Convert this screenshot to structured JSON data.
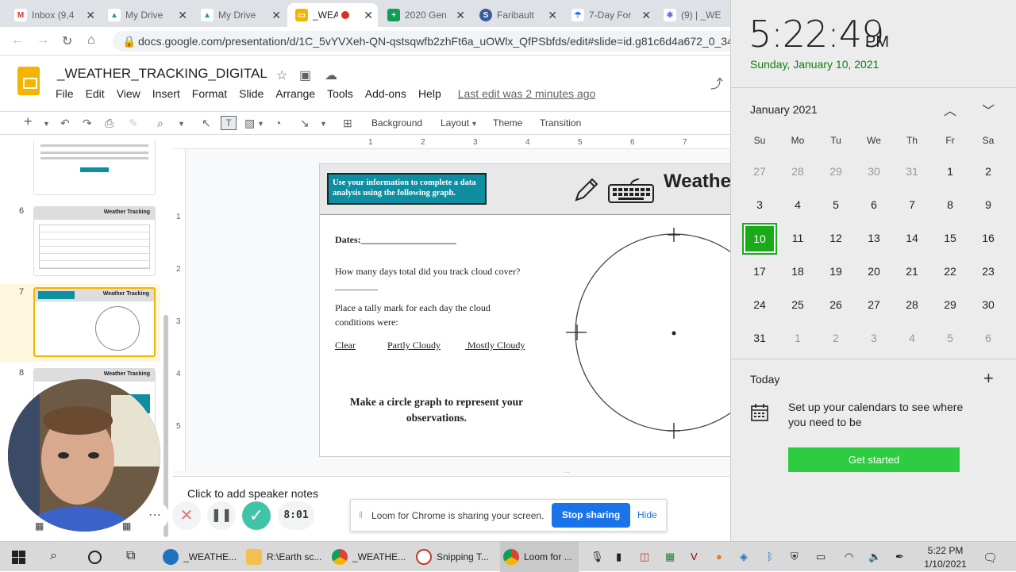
{
  "browser": {
    "tabs": [
      {
        "label": "Inbox (9,4",
        "fav_color": "#d93025",
        "fav": "M"
      },
      {
        "label": "My Drive",
        "fav_color": "#1fa463",
        "fav": "▲"
      },
      {
        "label": "My Drive",
        "fav_color": "#1fa463",
        "fav": "▲"
      },
      {
        "label": "_WEA",
        "fav_color": "#f4b400",
        "fav": "▭"
      },
      {
        "label": "2020 Gen",
        "fav_color": "#0f9d58",
        "fav": "+"
      },
      {
        "label": "Faribault",
        "fav_color": "#3a5ba0",
        "fav": "S"
      },
      {
        "label": "7-Day For",
        "fav_color": "#1a73e8",
        "fav": "☂"
      },
      {
        "label": "(9) | _WE",
        "fav_color": "#7b61ff",
        "fav": "✱"
      }
    ],
    "url": "docs.google.com/presentation/d/1C_5vYVXeh-QN-qstsqwfb2zhFt6a_uOWlx_QfPSbfds/edit#slide=id.g81c6d4a672_0_343"
  },
  "docs": {
    "title": "_WEATHER_TRACKING_DIGITAL",
    "menu": [
      "File",
      "Edit",
      "View",
      "Insert",
      "Format",
      "Slide",
      "Arrange",
      "Tools",
      "Add-ons",
      "Help"
    ],
    "last_edit": "Last edit was 2 minutes ago",
    "toolbar": {
      "background": "Background",
      "layout": "Layout",
      "theme": "Theme",
      "transition": "Transition"
    },
    "ruler_h": [
      "1",
      "2",
      "3",
      "4",
      "5",
      "6",
      "7"
    ],
    "ruler_v": [
      "1",
      "2",
      "3",
      "4",
      "5"
    ],
    "slide_numbers": [
      "6",
      "7",
      "8"
    ],
    "thumb_title": "Weather Tracking"
  },
  "slide": {
    "teal_box": "Use your information to  complete a data analysis using the following graph.",
    "title": "Weather",
    "dates": "Dates:____________________",
    "q1": "How many days total did you track cloud cover?_________",
    "q2": "Place a tally mark for each day the cloud conditions were:",
    "clear": "Clear",
    "partly": "Partly Cloudy",
    "mostly": " Mostly Cloudy",
    "make_graph": "Make a circle graph to represent your observations."
  },
  "notes": {
    "placeholder": "Click to add speaker notes"
  },
  "loom": {
    "sharing_msg": "Loom for Chrome is sharing your screen.",
    "stop": "Stop sharing",
    "hide": "Hide",
    "timer": "8:01"
  },
  "calendar": {
    "time": "5:22:49",
    "ampm": "PM",
    "date": "Sunday, January 10, 2021",
    "month": "January 2021",
    "dow": [
      "Su",
      "Mo",
      "Tu",
      "We",
      "Th",
      "Fr",
      "Sa"
    ],
    "weeks": [
      [
        "27",
        "28",
        "29",
        "30",
        "31",
        "1",
        "2"
      ],
      [
        "3",
        "4",
        "5",
        "6",
        "7",
        "8",
        "9"
      ],
      [
        "10",
        "11",
        "12",
        "13",
        "14",
        "15",
        "16"
      ],
      [
        "17",
        "18",
        "19",
        "20",
        "21",
        "22",
        "23"
      ],
      [
        "24",
        "25",
        "26",
        "27",
        "28",
        "29",
        "30"
      ],
      [
        "31",
        "1",
        "2",
        "3",
        "4",
        "5",
        "6"
      ]
    ],
    "today_label": "Today",
    "message": "Set up your calendars to see where you need to be",
    "get_started": "Get started",
    "accent": "#107c10"
  },
  "taskbar": {
    "apps": [
      {
        "label": "_WEATHE...",
        "color": "#1e73be"
      },
      {
        "label": "R:\\Earth sc...",
        "color": "#f2c14e"
      },
      {
        "label": "_WEATHE...",
        "color": "#db4437"
      },
      {
        "label": "Snipping T...",
        "color": "#c0392b"
      },
      {
        "label": "Loom for ...",
        "color": "#db4437"
      }
    ],
    "clock_time": "5:22 PM",
    "clock_date": "1/10/2021"
  }
}
